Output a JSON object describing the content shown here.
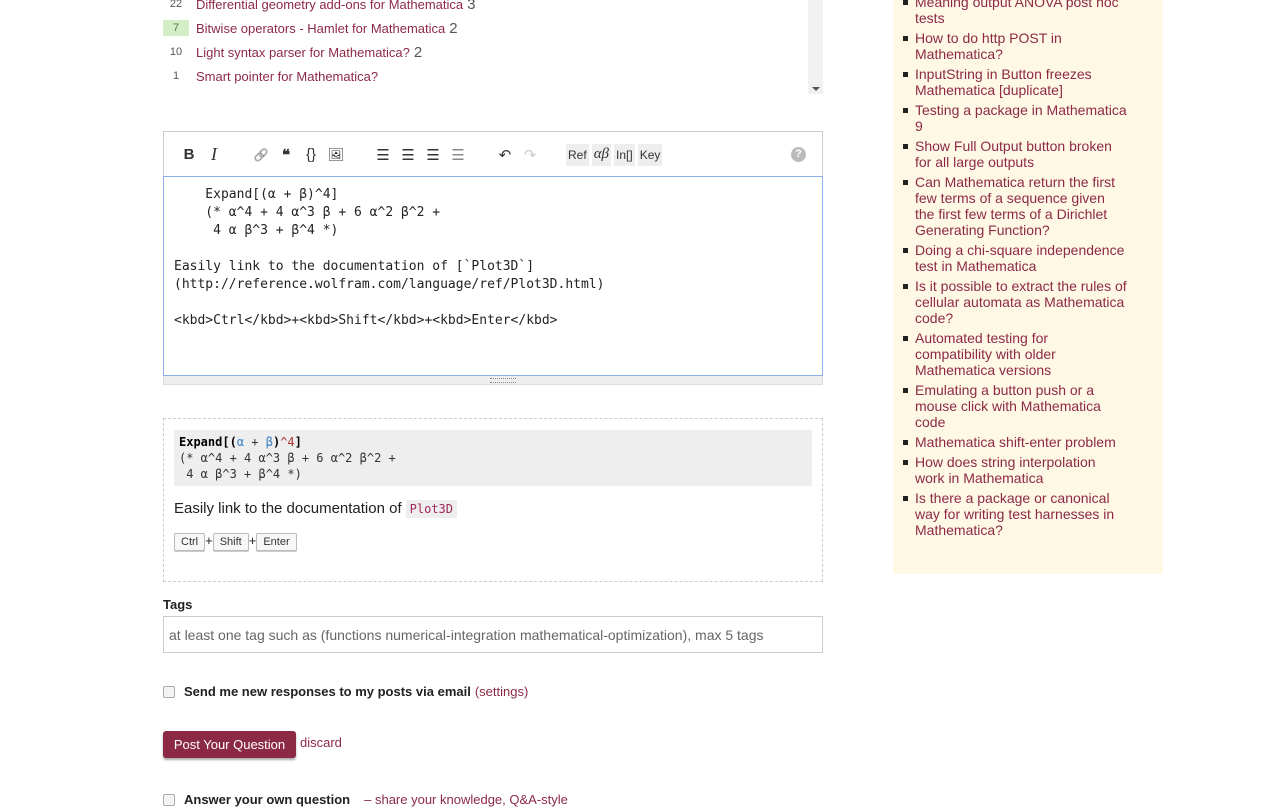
{
  "related": [
    {
      "score": "22",
      "title": "Differential geometry add-ons for Mathematica",
      "count": "3",
      "highlight": false
    },
    {
      "score": "7",
      "title": "Bitwise operators - Hamlet for Mathematica",
      "count": "2",
      "highlight": true
    },
    {
      "score": "10",
      "title": "Light syntax parser for Mathematica?",
      "count": "2",
      "highlight": false
    },
    {
      "score": "1",
      "title": "Smart pointer for Mathematica?",
      "count": "",
      "highlight": false
    }
  ],
  "toolbar": {
    "bold": "B",
    "italic": "I",
    "link": "🔗",
    "quote": "❝",
    "code": "{}",
    "image": "🖼",
    "ol": "☰",
    "ul": "☰",
    "heading": "☰",
    "hr": "☰",
    "undo": "↶",
    "redo": "↷",
    "ref": "Ref",
    "greek": "αβ",
    "input": "In[]",
    "key": "Key",
    "help": "?"
  },
  "editor": {
    "text": "    Expand[(α + β)^4]\n    (* α^4 + 4 α^3 β + 6 α^2 β^2 +\n     4 α β^3 + β^4 *)\n\nEasily link to the documentation of [`Plot3D`]\n(http://reference.wolfram.com/language/ref/Plot3D.html)\n\n<kbd>Ctrl</kbd>+<kbd>Shift</kbd>+<kbd>Enter</kbd>"
  },
  "preview": {
    "code_fn": "Expand",
    "code_open": "[(",
    "code_a": "α",
    "code_plus": " + ",
    "code_b": "β",
    "code_close": ")",
    "code_pow": "^4",
    "code_end": "]",
    "code_rest": "(* α^4 + 4 α^3 β + 6 α^2 β^2 +\n 4 α β^3 + β^4 *)",
    "text": "Easily link to the documentation of",
    "inline_code": "Plot3D",
    "keys": [
      "Ctrl",
      "Shift",
      "Enter"
    ],
    "plus": "+"
  },
  "tags": {
    "label": "Tags",
    "placeholder": "at least one tag such as (functions numerical-integration mathematical-optimization), max 5 tags"
  },
  "notify": {
    "label": "Send me new responses to my posts via email",
    "settings": "(settings)"
  },
  "answer_own": {
    "label": "Answer your own question",
    "text": "– share your knowledge, Q&A-style"
  },
  "post_button": "Post Your Question",
  "discard": "discard",
  "sidebar": [
    "Meaning output ANOVA post hoc tests",
    "How to do http POST in Mathematica?",
    "InputString in Button freezes Mathematica [duplicate]",
    "Testing a package in Mathematica 9",
    "Show Full Output button broken for all large outputs",
    "Can Mathematica return the first few terms of a sequence given the first few terms of a Dirichlet Generating Function?",
    "Doing a chi-square independence test in Mathematica",
    "Is it possible to extract the rules of cellular automata as Mathematica code?",
    "Automated testing for compatibility with older Mathematica versions",
    "Emulating a button push or a mouse click with Mathematica code",
    "Mathematica shift-enter problem",
    "How does string interpolation work in Mathematica",
    "Is there a package or canonical way for writing test harnesses in Mathematica?"
  ],
  "colors": {
    "link": "#8c2a46",
    "accent": "#8c2a46",
    "sidebar_bg": "#fff8e5"
  }
}
